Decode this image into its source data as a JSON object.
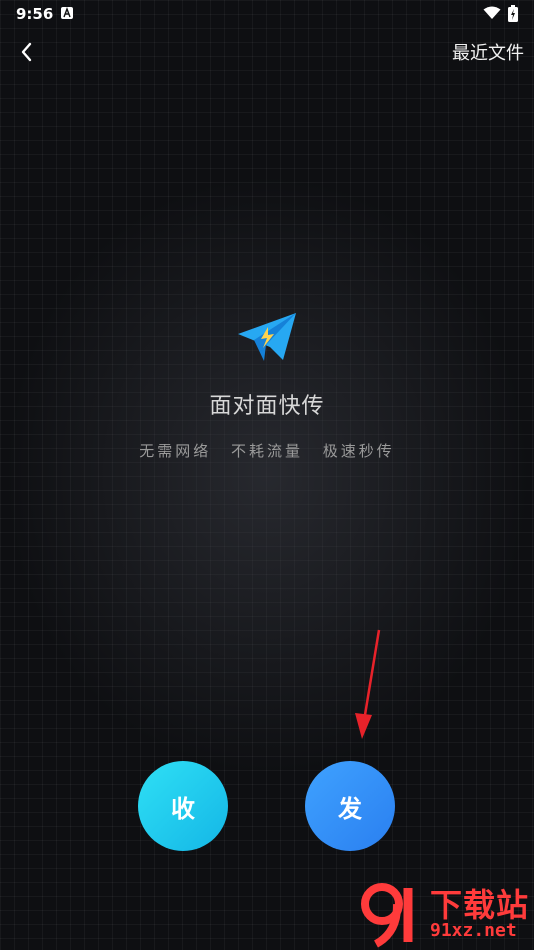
{
  "status_bar": {
    "time": "9:56",
    "icons": [
      "a-icon",
      "wifi-icon",
      "battery-icon"
    ]
  },
  "header": {
    "back_icon": "chevron-left-icon",
    "recent_files_label": "最近文件"
  },
  "main": {
    "icon": "paper-plane-icon",
    "title": "面对面快传",
    "subtitle_items": [
      "无需网络",
      "不耗流量",
      "极速秒传"
    ]
  },
  "actions": {
    "receive_label": "收",
    "send_label": "发"
  },
  "annotation": {
    "arrow_color": "#e8222a"
  },
  "watermark": {
    "text": "下载站",
    "domain": "91xz.net",
    "color": "#ff3b3b"
  },
  "colors": {
    "receive_button": "#21cbee",
    "send_button": "#358ff8",
    "plane": "#27a8f2"
  }
}
